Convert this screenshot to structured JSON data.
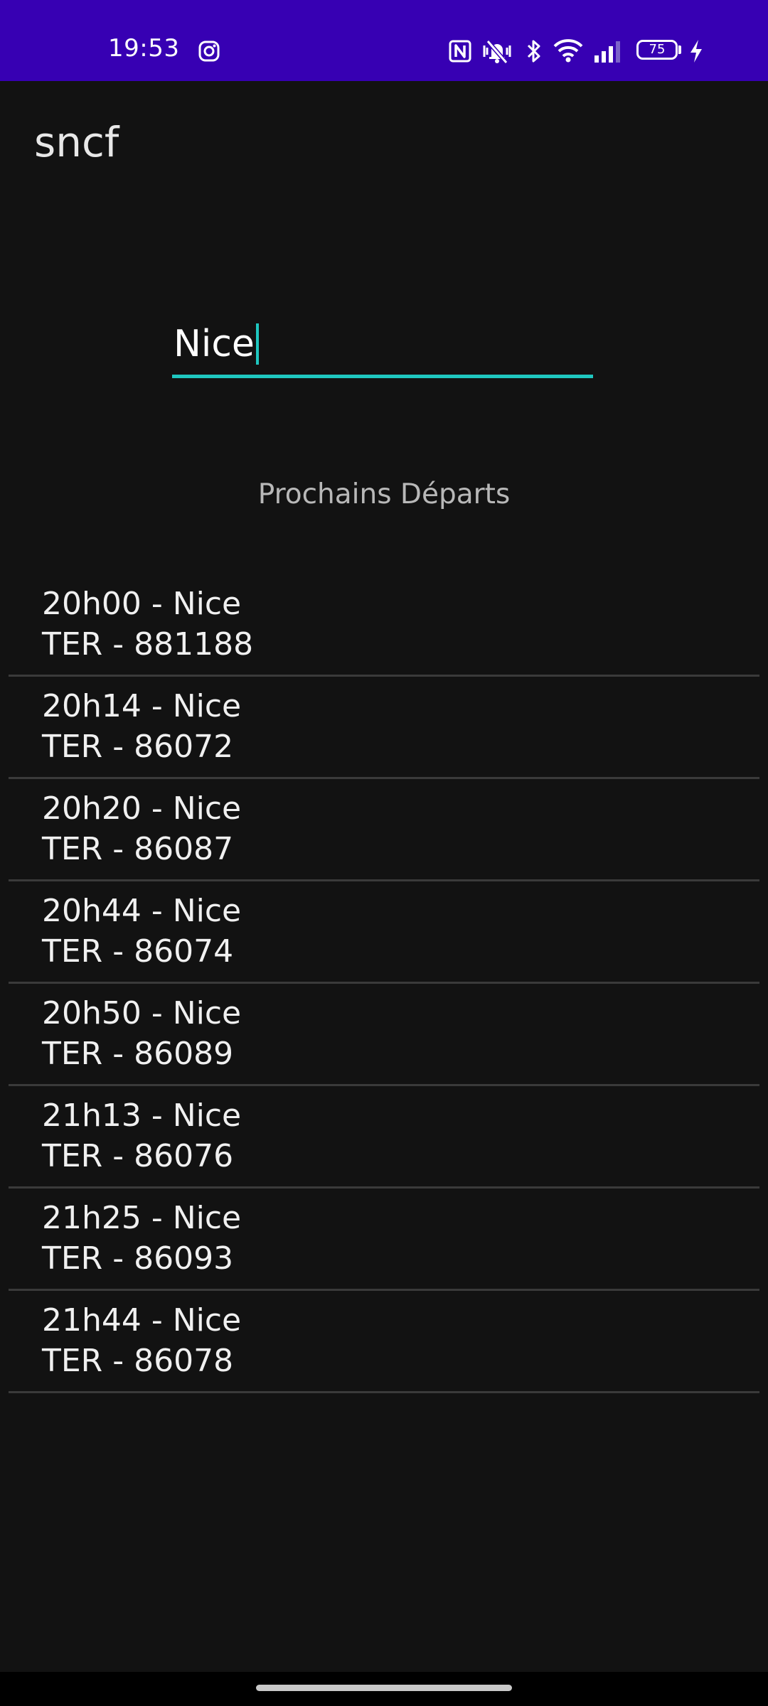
{
  "status_bar": {
    "time": "19:53",
    "battery_level": "75",
    "icons": [
      "instagram-icon",
      "nfc-icon",
      "mute-vibrate-icon",
      "bluetooth-icon",
      "wifi-icon",
      "cellular-signal-icon",
      "battery-icon",
      "charging-bolt-icon"
    ],
    "background_color": "#3700b3"
  },
  "app": {
    "title": "sncf"
  },
  "search": {
    "value": "Nice",
    "accent_color": "#1fc7c0"
  },
  "departures_heading": "Prochains Départs",
  "departures": [
    {
      "line1": "20h00 - Nice",
      "line2": "TER - 881188"
    },
    {
      "line1": "20h14 - Nice",
      "line2": "TER - 86072"
    },
    {
      "line1": "20h20 - Nice",
      "line2": "TER - 86087"
    },
    {
      "line1": "20h44 - Nice",
      "line2": "TER - 86074"
    },
    {
      "line1": "20h50 - Nice",
      "line2": "TER - 86089"
    },
    {
      "line1": "21h13 - Nice",
      "line2": "TER - 86076"
    },
    {
      "line1": "21h25 - Nice",
      "line2": "TER - 86093"
    },
    {
      "line1": "21h44 - Nice",
      "line2": "TER - 86078"
    }
  ]
}
